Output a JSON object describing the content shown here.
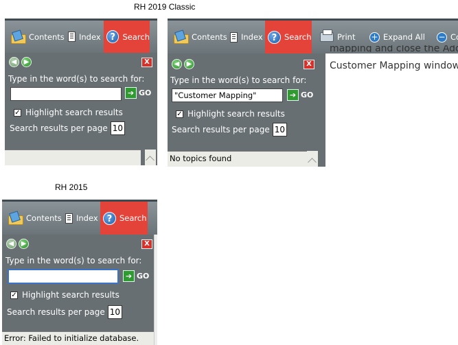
{
  "captions": {
    "classic": "RH 2019 Classic",
    "rh2015": "RH 2015"
  },
  "tabs": {
    "contents": "Contents",
    "index": "Index",
    "search": "Search",
    "print": "Print",
    "expand_all": "Expand All",
    "collapse_all_partial": "Co"
  },
  "search_panel": {
    "prompt": "Type in the word(s) to search for:",
    "go_label": "GO",
    "highlight_label": "Highlight search results",
    "per_page_label": "Search results per page",
    "per_page_value": "10",
    "close_glyph": "X"
  },
  "panel_classic_empty": {
    "query": "",
    "results_text": ""
  },
  "panel_classic_query": {
    "query": "\"Customer Mapping\"",
    "results_text": "No topics found"
  },
  "panel_2015": {
    "query": "",
    "results_text": "Error: Failed to initialize database."
  },
  "doc_text": {
    "line1": "mapping and close the Add",
    "line2": "Customer Mapping window."
  },
  "colors": {
    "active_tab": "#e4433a",
    "panel_body": "#676f73",
    "tab_bar": "#7a8388"
  }
}
